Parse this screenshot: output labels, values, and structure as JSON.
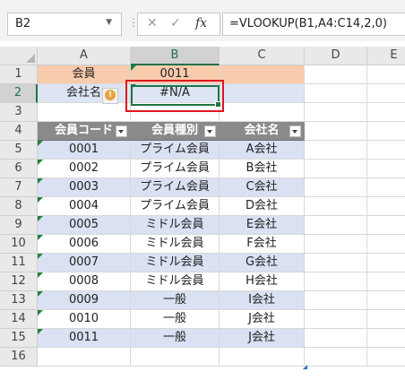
{
  "name_box": {
    "value": "B2"
  },
  "formula_bar": {
    "cancel_icon": "close-icon",
    "enter_icon": "checkmark-icon",
    "fx_label": "fx",
    "formula": "=VLOOKUP(B1,A4:C14,2,0)"
  },
  "columns": [
    "A",
    "B",
    "C",
    "D",
    "E"
  ],
  "rows": [
    "1",
    "2",
    "3",
    "4",
    "5",
    "6",
    "7",
    "8",
    "9",
    "10",
    "11",
    "12",
    "13",
    "14",
    "15",
    "16"
  ],
  "lookup": {
    "member_label": "会員",
    "member_value": "0011",
    "company_label": "会社名",
    "result": "#N/A",
    "error_icon": "warning-icon"
  },
  "table": {
    "headers": [
      "会員コード",
      "会員種別",
      "会社名"
    ],
    "rows": [
      [
        "0001",
        "プライム会員",
        "A会社"
      ],
      [
        "0002",
        "プライム会員",
        "B会社"
      ],
      [
        "0003",
        "プライム会員",
        "C会社"
      ],
      [
        "0004",
        "プライム会員",
        "D会社"
      ],
      [
        "0005",
        "ミドル会員",
        "E会社"
      ],
      [
        "0006",
        "ミドル会員",
        "F会社"
      ],
      [
        "0007",
        "ミドル会員",
        "G会社"
      ],
      [
        "0008",
        "ミドル会員",
        "H会社"
      ],
      [
        "0009",
        "一般",
        "I会社"
      ],
      [
        "0010",
        "一般",
        "J会社"
      ],
      [
        "0011",
        "一般",
        "J会社"
      ]
    ]
  },
  "colors": {
    "peach": "#f8cbad",
    "band": "#d9e1f2",
    "header": "#8a8a8a",
    "selection": "#217346",
    "highlight": "#e0141e"
  }
}
